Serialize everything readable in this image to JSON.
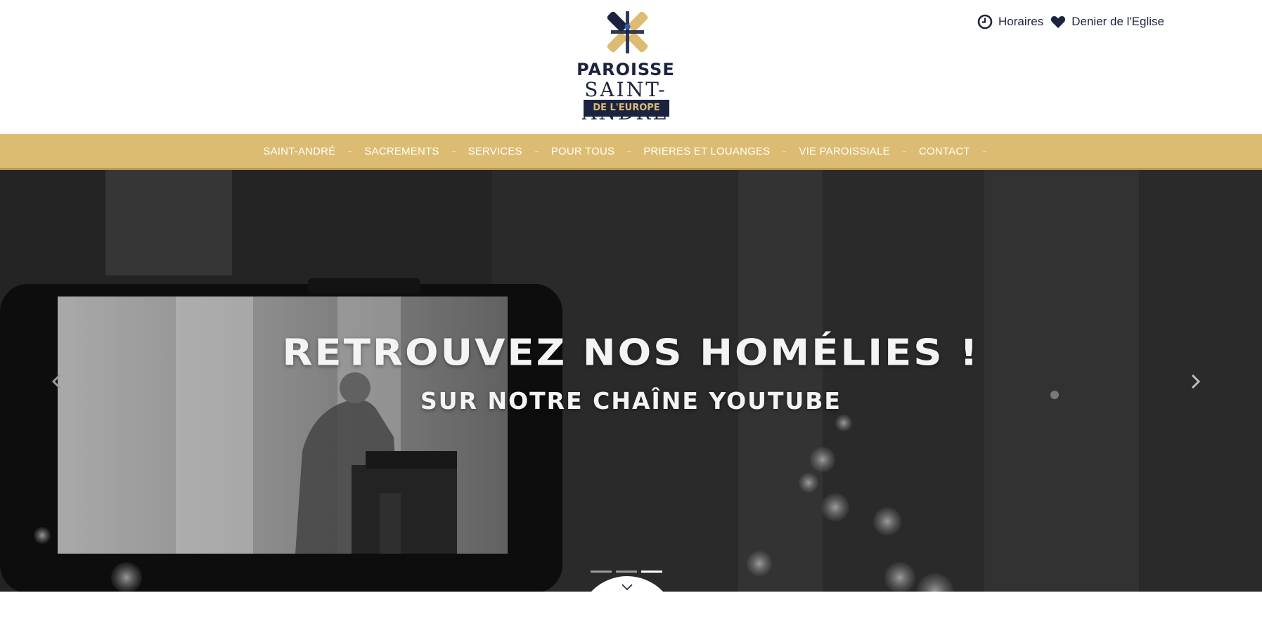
{
  "header": {
    "logo": {
      "line1": "PAROISSE",
      "line2": "SAINT-ANDRÉ",
      "line3": "DE L'EUROPE"
    },
    "top_links": [
      {
        "label": "Horaires",
        "icon": "clock-icon"
      },
      {
        "label": "Denier de l'Eglise",
        "icon": "heart-icon"
      }
    ]
  },
  "nav": {
    "items": [
      {
        "label": "SAINT-ANDRÉ"
      },
      {
        "label": "SACREMENTS"
      },
      {
        "label": "SERVICES"
      },
      {
        "label": "POUR TOUS"
      },
      {
        "label": "PRIERES ET LOUANGES"
      },
      {
        "label": "VIE PAROISSIALE"
      },
      {
        "label": "CONTACT"
      }
    ]
  },
  "hero": {
    "title": "RETROUVEZ NOS HOMÉLIES !",
    "subtitle": "SUR NOTRE CHAÎNE YOUTUBE",
    "active_slide": 3,
    "slide_count": 3
  },
  "colors": {
    "navy": "#1b2340",
    "gold": "#dcbc72"
  }
}
